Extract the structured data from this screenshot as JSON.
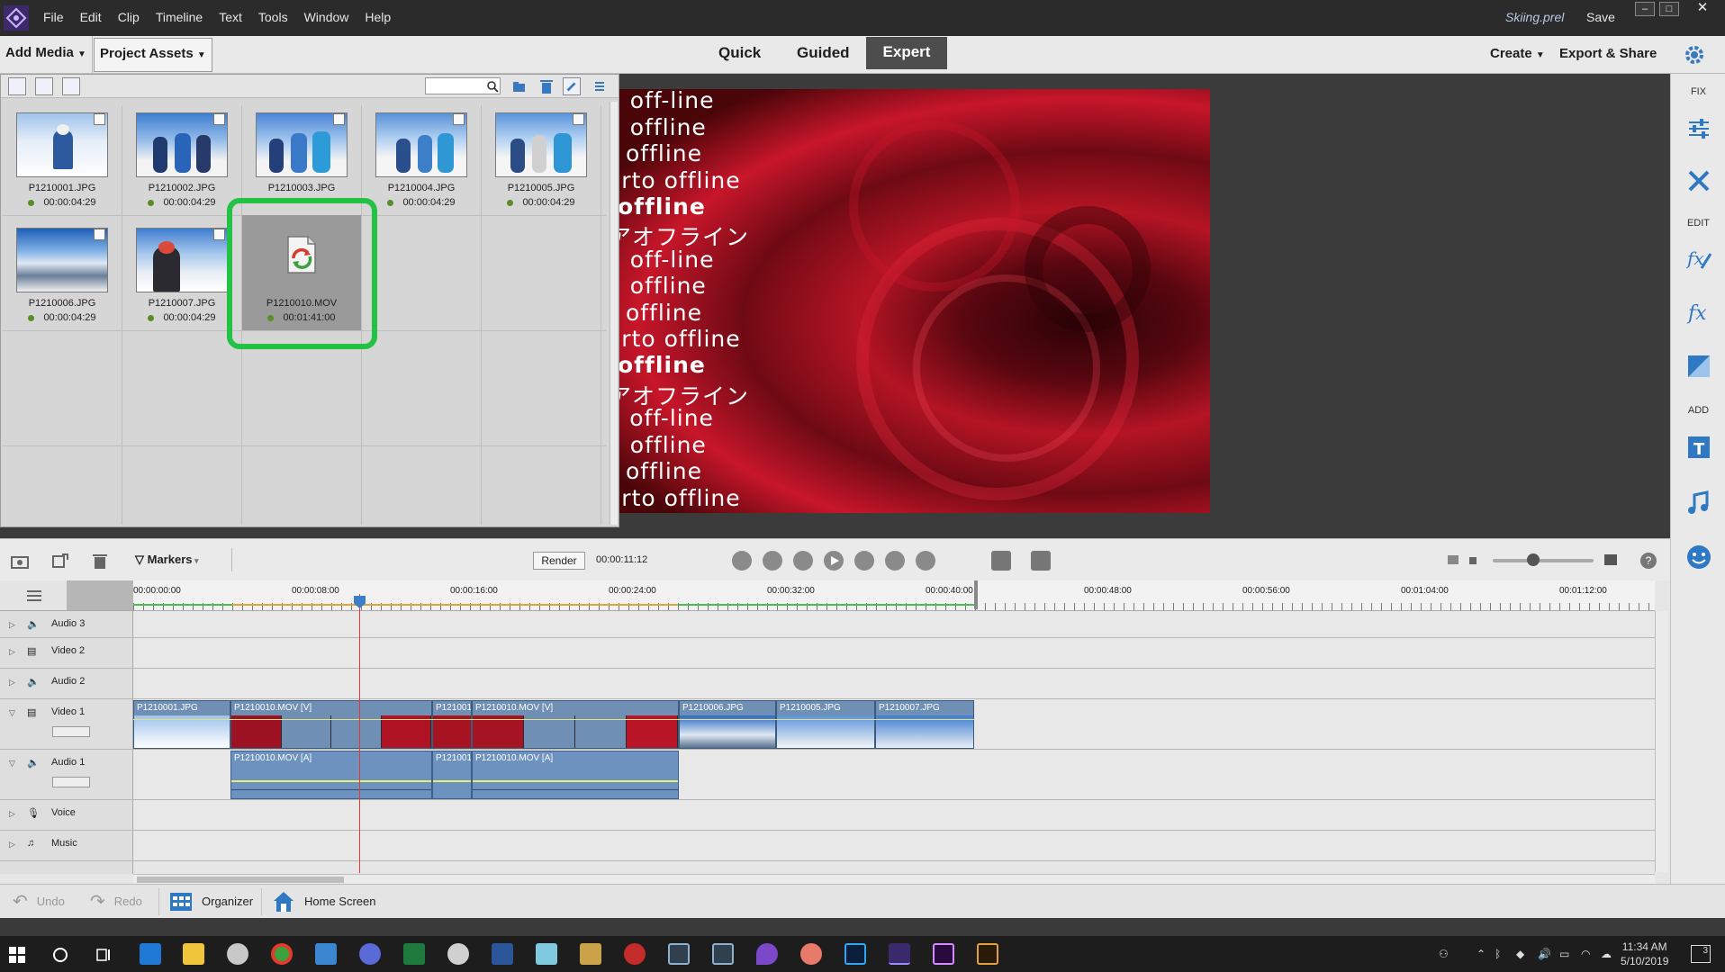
{
  "app": {
    "title": "Skiing.prel",
    "save_label": "Save",
    "menu": [
      "File",
      "Edit",
      "Clip",
      "Timeline",
      "Text",
      "Tools",
      "Window",
      "Help"
    ]
  },
  "toolbar": {
    "add_media": "Add Media",
    "project_assets": "Project Assets",
    "tabs": [
      "Quick",
      "Guided",
      "Expert"
    ],
    "active_tab": "Expert",
    "create": "Create",
    "export_share": "Export & Share"
  },
  "assets": {
    "search_placeholder": "",
    "items": [
      {
        "name": "P1210001.JPG",
        "duration": "00:00:04:29",
        "selected": false
      },
      {
        "name": "P1210002.JPG",
        "duration": "00:00:04:29",
        "selected": false
      },
      {
        "name": "P1210003.JPG",
        "duration": "",
        "selected": false
      },
      {
        "name": "P1210004.JPG",
        "duration": "00:00:04:29",
        "selected": false
      },
      {
        "name": "P1210005.JPG",
        "duration": "00:00:04:29",
        "selected": false
      },
      {
        "name": "P1210006.JPG",
        "duration": "00:00:04:29",
        "selected": false
      },
      {
        "name": "P1210007.JPG",
        "duration": "00:00:04:29",
        "selected": false
      },
      {
        "name": "P1210010.MOV",
        "duration": "00:01:41:00",
        "selected": true
      }
    ]
  },
  "preview": {
    "lines": [
      "n off-line",
      "n offline",
      "s offline",
      "orto offline",
      "offline",
      "アオフライン",
      "n off-line",
      "n offline",
      "s offline",
      "orto offline",
      "offline",
      "アオフライン",
      "a off-line",
      "n offline",
      "s offline",
      "orto offline"
    ]
  },
  "right_panel": {
    "fix_label": "FIX",
    "edit_label": "EDIT",
    "add_label": "ADD"
  },
  "timeline": {
    "markers_label": "Markers",
    "render_label": "Render",
    "current_time": "00:00:11:12",
    "ruler_labels": [
      "00:00:00:00",
      "00:00:08:00",
      "00:00:16:00",
      "00:00:24:00",
      "00:00:32:00",
      "00:00:40:00",
      "00:00:48:00",
      "00:00:56:00",
      "00:01:04:00",
      "00:01:12:00"
    ],
    "tracks": [
      "Audio 3",
      "Video 2",
      "Audio 2",
      "Video 1",
      "Audio 1",
      "Voice",
      "Music"
    ],
    "video_clips": [
      "P1210001.JPG",
      "P1210010.MOV [V]",
      "P121001",
      "P1210010.MOV [V]",
      "P1210006.JPG",
      "P1210005.JPG",
      "P1210007.JPG"
    ],
    "audio_clips": [
      "P1210010.MOV [A]",
      "P121001",
      "P1210010.MOV [A]"
    ]
  },
  "bottom_bar": {
    "undo": "Undo",
    "redo": "Redo",
    "organizer": "Organizer",
    "home_screen": "Home Screen"
  },
  "taskbar": {
    "time": "11:34 AM",
    "date": "5/10/2019",
    "notifications": "3"
  }
}
